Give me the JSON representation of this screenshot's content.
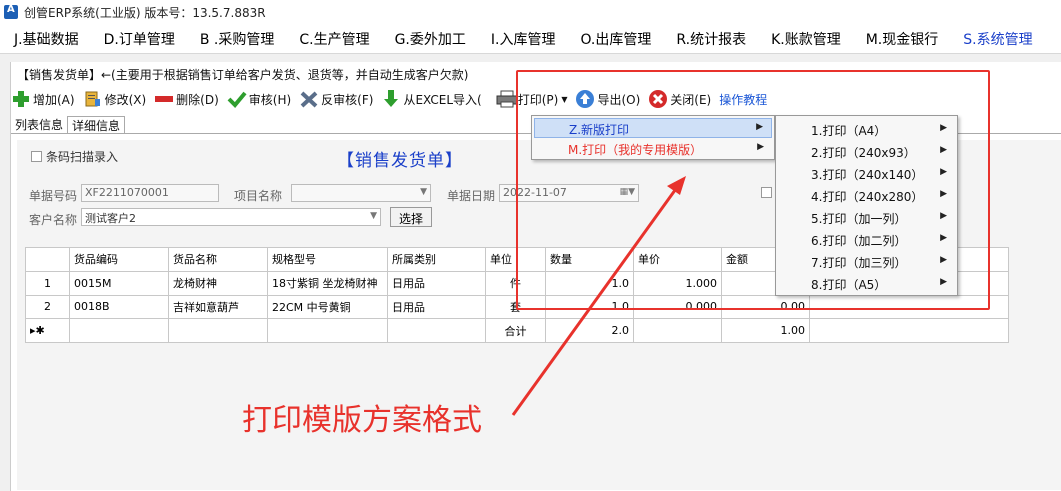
{
  "window": {
    "title": "创管ERP系统(工业版) 版本号：13.5.7.883R"
  },
  "menubar": [
    {
      "label": "J.基础数据"
    },
    {
      "label": "D.订单管理"
    },
    {
      "label": "B .采购管理"
    },
    {
      "label": "C.生产管理"
    },
    {
      "label": "G.委外加工"
    },
    {
      "label": "I.入库管理"
    },
    {
      "label": "O.出库管理"
    },
    {
      "label": "R.统计报表"
    },
    {
      "label": "K.账款管理"
    },
    {
      "label": "M.现金银行"
    },
    {
      "label": "S.系统管理"
    }
  ],
  "panel": {
    "title": "【销售发货单】←(主要用于根据销售订单给客户发货、退货等，并自动生成客户欠款)"
  },
  "toolbar": {
    "add": "增加(A)",
    "edit": "修改(X)",
    "delete": "删除(D)",
    "approve": "审核(H)",
    "unapprove": "反审核(F)",
    "import": "从EXCEL导入(",
    "print": "打印(P)",
    "export": "导出(O)",
    "close": "关闭(E)",
    "tutorial": "操作教程"
  },
  "tabs": {
    "list": "列表信息",
    "detail": "详细信息"
  },
  "form": {
    "barcode": "条码扫描录入",
    "title": "【销售发货单】",
    "doc_no_label": "单据号码",
    "doc_no": "XF2211070001",
    "project_label": "项目名称",
    "project": "",
    "date_label": "单据日期",
    "date": "2022-11-07",
    "customer_label": "客户名称",
    "customer": "测试客户2",
    "select_btn": "选择"
  },
  "grid": {
    "headers": [
      "货品编码",
      "货品名称",
      "规格型号",
      "所属类别",
      "单位",
      "数量",
      "单价",
      "金额"
    ],
    "rows": [
      {
        "idx": "1",
        "code": "0015M",
        "name": "龙椅财神",
        "spec": "18寸紫铜 坐龙椅财神",
        "cat": "日用品",
        "unit": "件",
        "qty": "1.0",
        "price": "1.000",
        "amount": ""
      },
      {
        "idx": "2",
        "code": "0018B",
        "name": "吉祥如意葫芦",
        "spec": "22CM 中号黄铜",
        "cat": "日用品",
        "unit": "套",
        "qty": "1.0",
        "price": "0.000",
        "amount": "0.00"
      }
    ],
    "new_row_marker": "▸✱",
    "total_label": "合计",
    "total_qty": "2.0",
    "total_amount": "1.00"
  },
  "print_menu": [
    {
      "label": "Z.新版打印"
    },
    {
      "label": "M.打印（我的专用模版）"
    }
  ],
  "print_submenu": [
    {
      "label": "1.打印（A4）"
    },
    {
      "label": "2.打印（240x93）"
    },
    {
      "label": "3.打印（240x140）"
    },
    {
      "label": "4.打印（240x280）"
    },
    {
      "label": "5.打印（加一列）"
    },
    {
      "label": "6.打印（加二列）"
    },
    {
      "label": "7.打印（加三列）"
    },
    {
      "label": "8.打印（A5）"
    }
  ],
  "annotation": "打印模版方案格式",
  "colors": {
    "accent": "#1a3fc9",
    "annotation": "#e8322c",
    "highlight": "#cfe0f7"
  }
}
